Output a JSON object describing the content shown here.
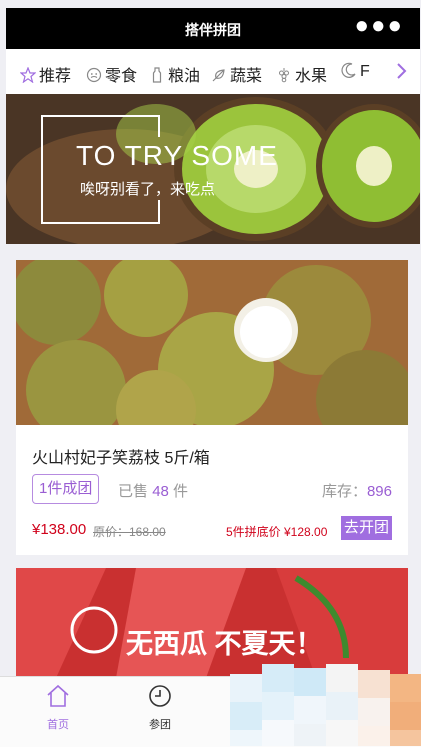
{
  "header": {
    "title": "搭伴拼团",
    "more_icon": "more-dots-icon"
  },
  "categories": [
    {
      "label": "推荐",
      "icon": "star-icon"
    },
    {
      "label": "零食",
      "icon": "smiley-icon"
    },
    {
      "label": "粮油",
      "icon": "bottle-icon"
    },
    {
      "label": "蔬菜",
      "icon": "leaf-icon"
    },
    {
      "label": "水果",
      "icon": "grape-icon"
    },
    {
      "label": "F",
      "icon": "moon-icon"
    }
  ],
  "banner": {
    "headline": "TO TRY SOME",
    "subtitle": "唉呀别看了，来吃点"
  },
  "product": {
    "name": "火山村妃子笑荔枝 5斤/箱",
    "group_tag": "1件成团",
    "sold_label": "已售",
    "sold_count": "48",
    "sold_unit": "件",
    "stock_label": "库存：",
    "stock_count": "896",
    "price": "¥138.00",
    "original_price": "原价：168.00",
    "group_price": "5件拼底价 ¥128.00",
    "open_button": "去开团"
  },
  "promo": {
    "slogan": "无西瓜 不夏天！"
  },
  "tabbar": {
    "items": [
      {
        "label": "首页",
        "icon": "home-icon",
        "active": true
      },
      {
        "label": "参团",
        "icon": "clock-icon",
        "active": false
      }
    ]
  },
  "colors": {
    "accent": "#9a5ed3",
    "price": "#d0021b",
    "header_bg": "#000000"
  }
}
